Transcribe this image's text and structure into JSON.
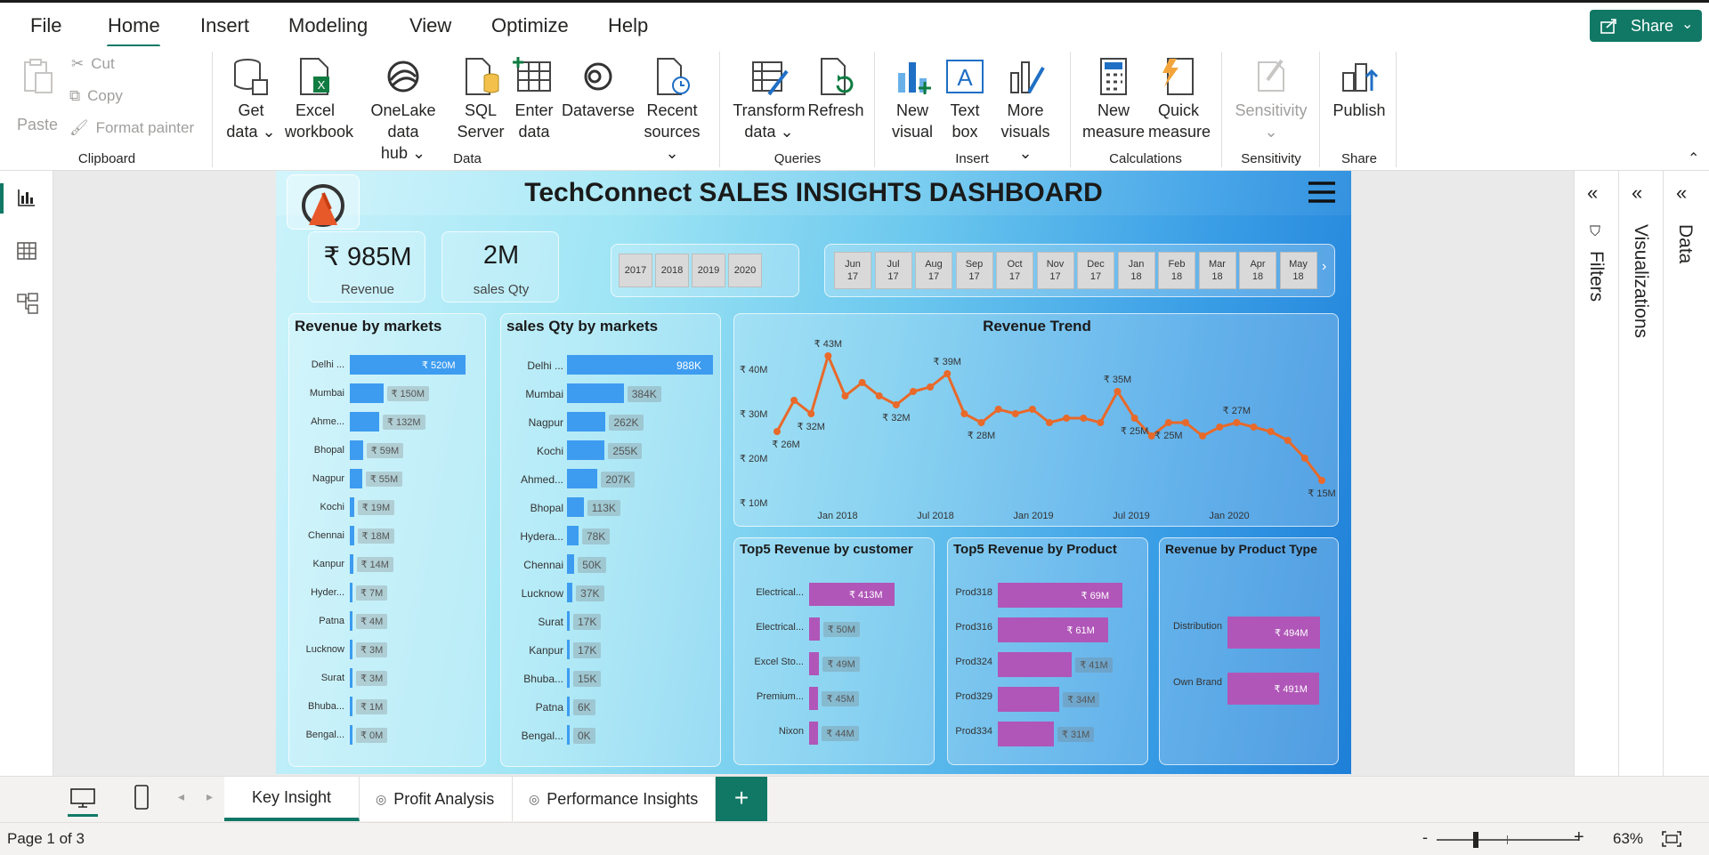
{
  "menu": {
    "items": [
      "File",
      "Home",
      "Insert",
      "Modeling",
      "View",
      "Optimize",
      "Help"
    ],
    "active": "Home",
    "share_label": "Share"
  },
  "ribbon": {
    "clipboard": {
      "paste": "Paste",
      "cut": "Cut",
      "copy": "Copy",
      "format_painter": "Format painter",
      "label": "Clipboard"
    },
    "data": {
      "get_data": [
        "Get",
        "data"
      ],
      "excel": [
        "Excel",
        "workbook"
      ],
      "onelake": [
        "OneLake data",
        "hub"
      ],
      "sql": [
        "SQL",
        "Server"
      ],
      "enter": [
        "Enter",
        "data"
      ],
      "dataverse": "Dataverse",
      "recent": [
        "Recent",
        "sources"
      ],
      "label": "Data"
    },
    "queries": {
      "transform": [
        "Transform",
        "data"
      ],
      "refresh": "Refresh",
      "label": "Queries"
    },
    "insert": {
      "new_visual": [
        "New",
        "visual"
      ],
      "text_box": [
        "Text",
        "box"
      ],
      "more_visuals": [
        "More",
        "visuals"
      ],
      "label": "Insert"
    },
    "calculations": {
      "new_measure": [
        "New",
        "measure"
      ],
      "quick_measure": [
        "Quick",
        "measure"
      ],
      "label": "Calculations"
    },
    "sensitivity": {
      "btn": "Sensitivity",
      "label": "Sensitivity"
    },
    "share": {
      "publish": "Publish",
      "label": "Share"
    }
  },
  "report": {
    "title": "TechConnect SALES INSIGHTS DASHBOARD",
    "kpis": [
      {
        "value": "₹ 985M",
        "label": "Revenue"
      },
      {
        "value": "2M",
        "label": "sales Qty"
      }
    ],
    "years": [
      "2017",
      "2018",
      "2019",
      "2020"
    ],
    "months": [
      [
        "Jun",
        "17"
      ],
      [
        "Jul",
        "17"
      ],
      [
        "Aug",
        "17"
      ],
      [
        "Sep",
        "17"
      ],
      [
        "Oct",
        "17"
      ],
      [
        "Nov",
        "17"
      ],
      [
        "Dec",
        "17"
      ],
      [
        "Jan",
        "18"
      ],
      [
        "Feb",
        "18"
      ],
      [
        "Mar",
        "18"
      ],
      [
        "Apr",
        "18"
      ],
      [
        "May",
        "18"
      ]
    ],
    "revenue_by_markets": {
      "title": "Revenue by markets",
      "color": "#3d9cf0",
      "items": [
        {
          "label": "Delhi ...",
          "value": 520,
          "text": "₹ 520M"
        },
        {
          "label": "Mumbai",
          "value": 150,
          "text": "₹ 150M"
        },
        {
          "label": "Ahme...",
          "value": 132,
          "text": "₹ 132M"
        },
        {
          "label": "Bhopal",
          "value": 59,
          "text": "₹ 59M"
        },
        {
          "label": "Nagpur",
          "value": 55,
          "text": "₹ 55M"
        },
        {
          "label": "Kochi",
          "value": 19,
          "text": "₹ 19M"
        },
        {
          "label": "Chennai",
          "value": 18,
          "text": "₹ 18M"
        },
        {
          "label": "Kanpur",
          "value": 14,
          "text": "₹ 14M"
        },
        {
          "label": "Hyder...",
          "value": 7,
          "text": "₹ 7M"
        },
        {
          "label": "Patna",
          "value": 4,
          "text": "₹ 4M"
        },
        {
          "label": "Lucknow",
          "value": 3,
          "text": "₹ 3M"
        },
        {
          "label": "Surat",
          "value": 3,
          "text": "₹ 3M"
        },
        {
          "label": "Bhuba...",
          "value": 1,
          "text": "₹ 1M"
        },
        {
          "label": "Bengal...",
          "value": 0,
          "text": "₹ 0M"
        }
      ]
    },
    "qty_by_markets": {
      "title": "sales Qty by markets",
      "color": "#3d9cf0",
      "items": [
        {
          "label": "Delhi ...",
          "value": 988,
          "text": "988K"
        },
        {
          "label": "Mumbai",
          "value": 384,
          "text": "384K"
        },
        {
          "label": "Nagpur",
          "value": 262,
          "text": "262K"
        },
        {
          "label": "Kochi",
          "value": 255,
          "text": "255K"
        },
        {
          "label": "Ahmed...",
          "value": 207,
          "text": "207K"
        },
        {
          "label": "Bhopal",
          "value": 113,
          "text": "113K"
        },
        {
          "label": "Hydera...",
          "value": 78,
          "text": "78K"
        },
        {
          "label": "Chennai",
          "value": 50,
          "text": "50K"
        },
        {
          "label": "Lucknow",
          "value": 37,
          "text": "37K"
        },
        {
          "label": "Surat",
          "value": 17,
          "text": "17K"
        },
        {
          "label": "Kanpur",
          "value": 17,
          "text": "17K"
        },
        {
          "label": "Bhuba...",
          "value": 15,
          "text": "15K"
        },
        {
          "label": "Patna",
          "value": 6,
          "text": "6K"
        },
        {
          "label": "Bengal...",
          "value": 0,
          "text": "0K"
        }
      ]
    },
    "revenue_trend": {
      "title": "Revenue Trend",
      "color": "#e8692a",
      "y_ticks": [
        "₹ 40M",
        "₹ 30M",
        "₹ 20M",
        "₹ 10M"
      ],
      "x_ticks": [
        "Jan 2018",
        "Jul 2018",
        "Jan 2019",
        "Jul 2019",
        "Jan 2020"
      ],
      "values": [
        26,
        33,
        30,
        43,
        34,
        37,
        34,
        32,
        35,
        36,
        39,
        30,
        28,
        31,
        30,
        31,
        28,
        29,
        29,
        28,
        35,
        29,
        25,
        28,
        28,
        25,
        27,
        28,
        27,
        26,
        24,
        20,
        15
      ],
      "point_labels": {
        "0": "₹ 26M",
        "2": "₹ 32M",
        "3": "₹ 43M",
        "7": "₹ 32M",
        "10": "₹ 39M",
        "12": "₹ 28M",
        "20": "₹ 35M",
        "21": "₹ 25M",
        "23": "₹ 25M",
        "27": "₹ 27M",
        "32": "₹ 15M"
      }
    },
    "top5_customer": {
      "title": "Top5 Revenue by customer",
      "color": "#b056b8",
      "items": [
        {
          "label": "Electrical...",
          "value": 413,
          "text": "₹ 413M"
        },
        {
          "label": "Electrical...",
          "value": 50,
          "text": "₹ 50M"
        },
        {
          "label": "Excel Sto...",
          "value": 49,
          "text": "₹ 49M"
        },
        {
          "label": "Premium...",
          "value": 45,
          "text": "₹ 45M"
        },
        {
          "label": "Nixon",
          "value": 44,
          "text": "₹ 44M"
        }
      ]
    },
    "top5_product": {
      "title": "Top5 Revenue by Product",
      "color": "#b056b8",
      "items": [
        {
          "label": "Prod318",
          "value": 69,
          "text": "₹ 69M"
        },
        {
          "label": "Prod316",
          "value": 61,
          "text": "₹ 61M"
        },
        {
          "label": "Prod324",
          "value": 41,
          "text": "₹ 41M"
        },
        {
          "label": "Prod329",
          "value": 34,
          "text": "₹ 34M"
        },
        {
          "label": "Prod334",
          "value": 31,
          "text": "₹ 31M"
        }
      ]
    },
    "product_type": {
      "title": "Revenue by Product Type",
      "color": "#b056b8",
      "items": [
        {
          "label": "Distribution",
          "value": 494,
          "text": "₹ 494M"
        },
        {
          "label": "Own Brand",
          "value": 491,
          "text": "₹ 491M"
        }
      ]
    }
  },
  "panes": {
    "filters": "Filters",
    "visualizations": "Visualizations",
    "data": "Data"
  },
  "tabs": [
    "Key Insight",
    "Profit Analysis",
    "Performance Insights"
  ],
  "status": {
    "page": "Page 1 of 3",
    "zoom": "63%"
  },
  "chart_data": [
    {
      "type": "bar",
      "title": "Revenue by markets",
      "categories": [
        "Delhi ...",
        "Mumbai",
        "Ahme...",
        "Bhopal",
        "Nagpur",
        "Kochi",
        "Chennai",
        "Kanpur",
        "Hyder...",
        "Patna",
        "Lucknow",
        "Surat",
        "Bhuba...",
        "Bengal..."
      ],
      "values": [
        520,
        150,
        132,
        59,
        55,
        19,
        18,
        14,
        7,
        4,
        3,
        3,
        1,
        0
      ]
    },
    {
      "type": "bar",
      "title": "sales Qty by markets",
      "categories": [
        "Delhi ...",
        "Mumbai",
        "Nagpur",
        "Kochi",
        "Ahmed...",
        "Bhopal",
        "Hydera...",
        "Chennai",
        "Lucknow",
        "Surat",
        "Kanpur",
        "Bhuba...",
        "Patna",
        "Bengal..."
      ],
      "values": [
        988,
        384,
        262,
        255,
        207,
        113,
        78,
        50,
        37,
        17,
        17,
        15,
        6,
        0
      ]
    },
    {
      "type": "line",
      "title": "Revenue Trend",
      "values": [
        26,
        33,
        30,
        43,
        34,
        37,
        34,
        32,
        35,
        36,
        39,
        30,
        28,
        31,
        30,
        31,
        28,
        29,
        29,
        28,
        35,
        29,
        25,
        28,
        28,
        25,
        27,
        28,
        27,
        26,
        24,
        20,
        15
      ]
    },
    {
      "type": "bar",
      "title": "Top5 Revenue by customer",
      "categories": [
        "Electrical...",
        "Electrical...",
        "Excel Sto...",
        "Premium...",
        "Nixon"
      ],
      "values": [
        413,
        50,
        49,
        45,
        44
      ]
    },
    {
      "type": "bar",
      "title": "Top5 Revenue by Product",
      "categories": [
        "Prod318",
        "Prod316",
        "Prod324",
        "Prod329",
        "Prod334"
      ],
      "values": [
        69,
        61,
        41,
        34,
        31
      ]
    },
    {
      "type": "bar",
      "title": "Revenue by Product Type",
      "categories": [
        "Distribution",
        "Own Brand"
      ],
      "values": [
        494,
        491
      ]
    }
  ]
}
